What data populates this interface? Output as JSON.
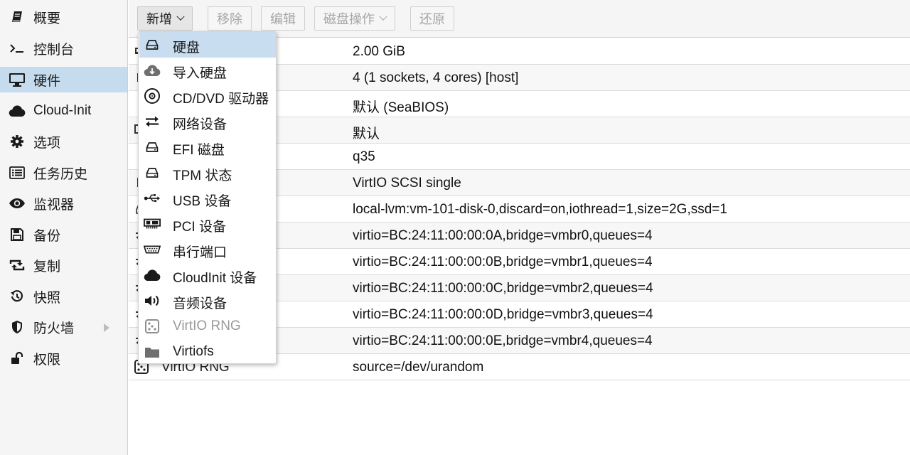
{
  "sidebar": {
    "items": [
      {
        "label": "概要",
        "icon": "book-icon"
      },
      {
        "label": "控制台",
        "icon": "terminal-icon"
      },
      {
        "label": "硬件",
        "icon": "desktop-icon",
        "active": true
      },
      {
        "label": "Cloud-Init",
        "icon": "cloud-icon"
      },
      {
        "label": "选项",
        "icon": "gear-icon"
      },
      {
        "label": "任务历史",
        "icon": "list-icon"
      },
      {
        "label": "监视器",
        "icon": "eye-icon"
      },
      {
        "label": "备份",
        "icon": "floppy-icon"
      },
      {
        "label": "复制",
        "icon": "retweet-icon"
      },
      {
        "label": "快照",
        "icon": "history-icon"
      },
      {
        "label": "防火墙",
        "icon": "shield-icon",
        "expandable": true
      },
      {
        "label": "权限",
        "icon": "unlock-icon"
      }
    ]
  },
  "toolbar": {
    "add_label": "新增",
    "remove_label": "移除",
    "edit_label": "编辑",
    "disk_action_label": "磁盘操作",
    "revert_label": "还原"
  },
  "hardware_rows": [
    {
      "icon": "memory-icon",
      "name": "",
      "value": "2.00 GiB"
    },
    {
      "icon": "cpu-icon",
      "name": "",
      "value": "4 (1 sockets, 4 cores) [host]"
    },
    {
      "icon": "microchip-icon",
      "name": "",
      "value": "默认 (SeaBIOS)"
    },
    {
      "icon": "desktop-icon",
      "name": "",
      "value": "默认"
    },
    {
      "icon": "gears-icon",
      "name": "",
      "value": "q35"
    },
    {
      "icon": "database-icon",
      "name": "",
      "value": "VirtIO SCSI single"
    },
    {
      "icon": "hdd-icon",
      "name": "",
      "value": "local-lvm:vm-101-disk-0,discard=on,iothread=1,size=2G,ssd=1"
    },
    {
      "icon": "exchange-icon",
      "name": "",
      "value": "virtio=BC:24:11:00:00:0A,bridge=vmbr0,queues=4"
    },
    {
      "icon": "exchange-icon",
      "name": "",
      "value": "virtio=BC:24:11:00:00:0B,bridge=vmbr1,queues=4"
    },
    {
      "icon": "exchange-icon",
      "name": "",
      "value": "virtio=BC:24:11:00:00:0C,bridge=vmbr2,queues=4"
    },
    {
      "icon": "exchange-icon",
      "name": "",
      "value": "virtio=BC:24:11:00:00:0D,bridge=vmbr3,queues=4"
    },
    {
      "icon": "exchange-icon",
      "name": "",
      "value": "virtio=BC:24:11:00:00:0E,bridge=vmbr4,queues=4"
    },
    {
      "icon": "dice-icon",
      "name": "VirtIO RNG",
      "value": "source=/dev/urandom"
    }
  ],
  "add_menu": {
    "items": [
      {
        "label": "硬盘",
        "icon": "hdd-icon",
        "active": true
      },
      {
        "label": "导入硬盘",
        "icon": "cloud-download-icon"
      },
      {
        "label": "CD/DVD 驱动器",
        "icon": "cd-icon"
      },
      {
        "label": "网络设备",
        "icon": "exchange-icon"
      },
      {
        "label": "EFI 磁盘",
        "icon": "hdd-icon"
      },
      {
        "label": "TPM 状态",
        "icon": "hdd-icon"
      },
      {
        "label": "USB 设备",
        "icon": "usb-icon"
      },
      {
        "label": "PCI 设备",
        "icon": "pci-card-icon"
      },
      {
        "label": "串行端口",
        "icon": "serial-port-icon"
      },
      {
        "label": "CloudInit 设备",
        "icon": "cloud-icon"
      },
      {
        "label": "音频设备",
        "icon": "volume-icon"
      },
      {
        "label": "VirtIO RNG",
        "icon": "dice-icon",
        "disabled": true
      },
      {
        "label": "Virtiofs",
        "icon": "folder-icon"
      }
    ]
  },
  "colors": {
    "selection": "#c5dcef",
    "sidebar_bg": "#f5f5f5",
    "disabled_text": "#a6a6a6"
  }
}
